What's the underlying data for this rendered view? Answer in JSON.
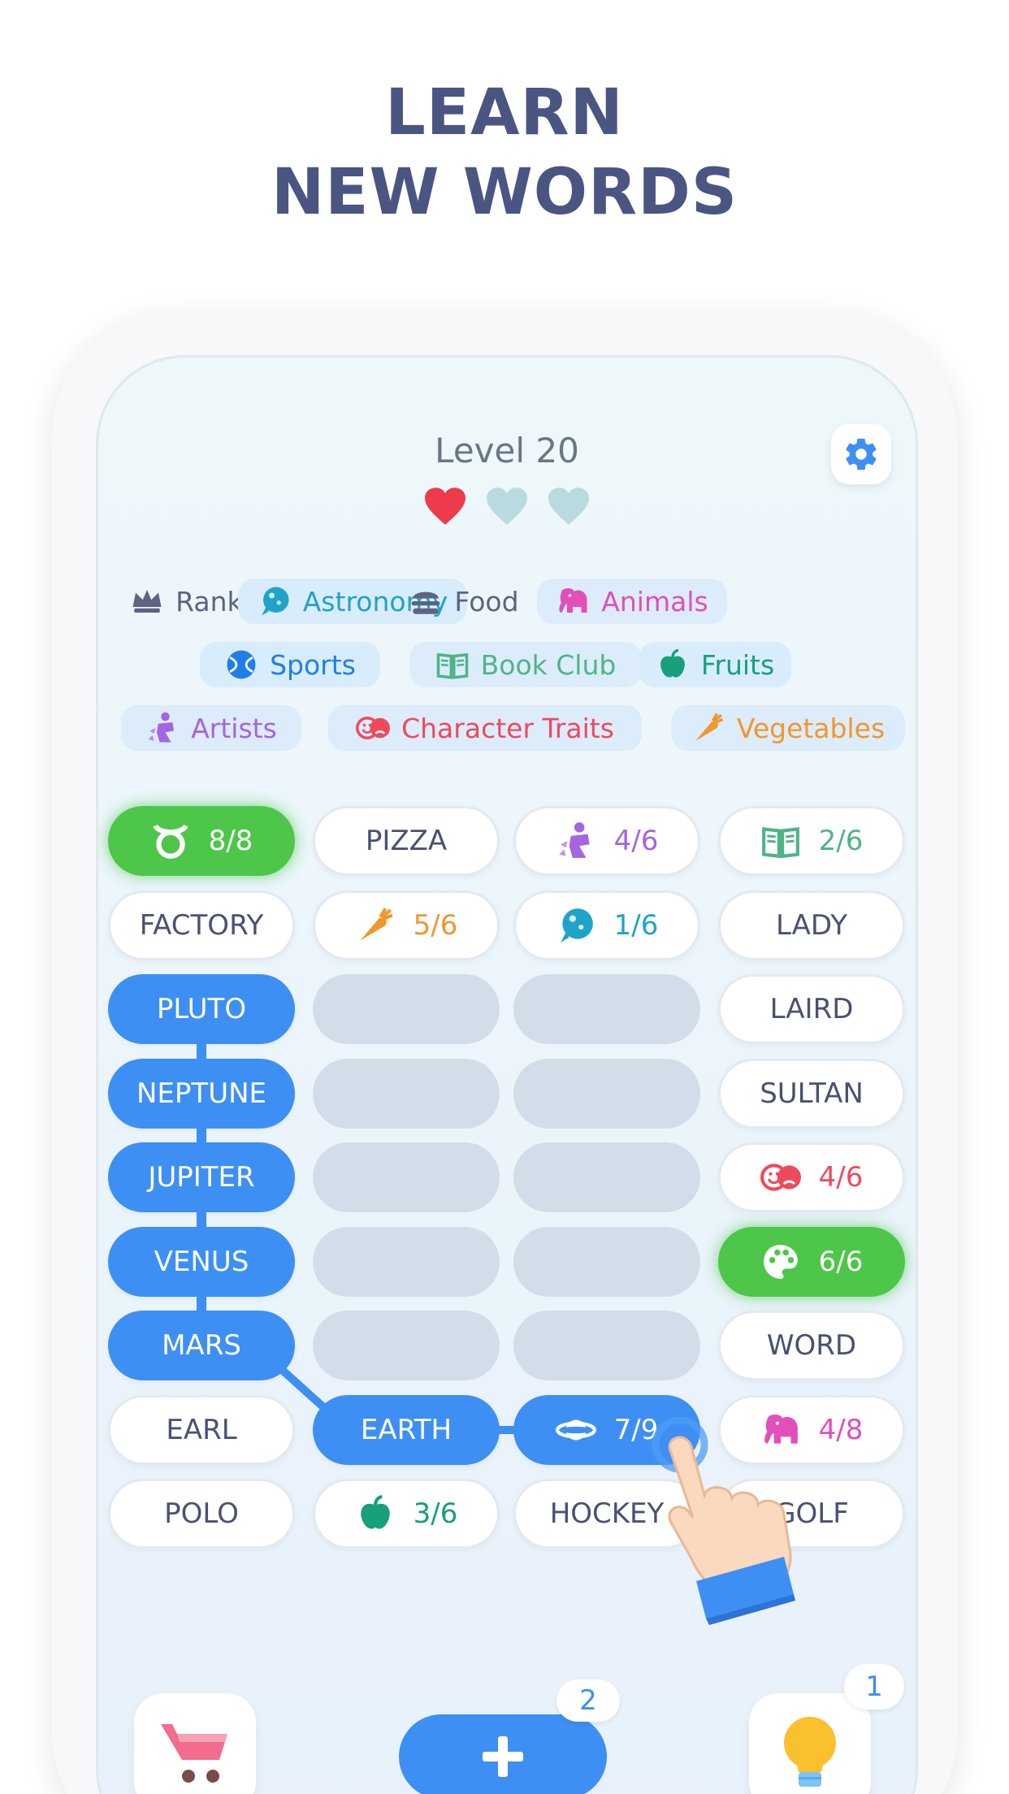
{
  "headline": {
    "line1": "LEARN",
    "line2": "NEW WORDS"
  },
  "level": {
    "title": "Level 20",
    "lives_total": 3,
    "lives_filled": 1
  },
  "colors": {
    "accent_blue": "#3d8ff3",
    "success_green": "#4dc64a",
    "heart_red": "#ef3a4c",
    "heart_empty": "#b9dbe0",
    "headline": "#4a5582"
  },
  "categories": [
    {
      "label": "Ranks",
      "icon": "crown-icon",
      "color": "#5d6380",
      "bg": "transparent"
    },
    {
      "label": "Astronomy",
      "icon": "planet-icon",
      "color": "#1fa3c9",
      "bg": "#d9ecfb"
    },
    {
      "label": "Food",
      "icon": "burger-icon",
      "color": "#5d6380",
      "bg": "transparent"
    },
    {
      "label": "Animals",
      "icon": "elephant-icon",
      "color": "#e24fba",
      "bg": "#dcecfb"
    },
    {
      "label": "Sports",
      "icon": "ball-icon",
      "color": "#1f7fe6",
      "bg": "#d9ecfb"
    },
    {
      "label": "Book Club",
      "icon": "book-icon",
      "color": "#4fb488",
      "bg": "#dcecfb"
    },
    {
      "label": "Fruits",
      "icon": "apple-icon",
      "color": "#17a07a",
      "bg": "#d9ecfb"
    },
    {
      "label": "Artists",
      "icon": "artist-icon",
      "color": "#a465e2",
      "bg": "#dcecfb"
    },
    {
      "label": "Character Traits",
      "icon": "masks-icon",
      "color": "#ee4a5c",
      "bg": "#dcecfb"
    },
    {
      "label": "Vegetables",
      "icon": "carrot-icon",
      "color": "#f0972e",
      "bg": "#dcecfb"
    }
  ],
  "grid": [
    [
      {
        "text": "8/8",
        "icon": "taurus-icon",
        "style": "green"
      },
      {
        "text": "PIZZA",
        "style": "white"
      },
      {
        "text": "4/6",
        "icon": "artist-icon",
        "style": "white",
        "color": "#a465e2"
      },
      {
        "text": "2/6",
        "icon": "book-icon",
        "style": "white",
        "color": "#4fb488"
      }
    ],
    [
      {
        "text": "FACTORY",
        "style": "white"
      },
      {
        "text": "5/6",
        "icon": "carrot-icon",
        "style": "white",
        "color": "#f0972e"
      },
      {
        "text": "1/6",
        "icon": "planet-icon",
        "style": "white",
        "color": "#1fa3c9"
      },
      {
        "text": "LADY",
        "style": "white"
      }
    ],
    [
      {
        "text": "PLUTO",
        "style": "blue"
      },
      {
        "text": "",
        "style": "empty"
      },
      {
        "text": "",
        "style": "empty"
      },
      {
        "text": "LAIRD",
        "style": "white"
      }
    ],
    [
      {
        "text": "NEPTUNE",
        "style": "blue"
      },
      {
        "text": "",
        "style": "empty"
      },
      {
        "text": "",
        "style": "empty"
      },
      {
        "text": "SULTAN",
        "style": "white"
      }
    ],
    [
      {
        "text": "JUPITER",
        "style": "blue"
      },
      {
        "text": "",
        "style": "empty"
      },
      {
        "text": "",
        "style": "empty"
      },
      {
        "text": "4/6",
        "icon": "masks-icon",
        "style": "white",
        "color": "#ee4a5c"
      }
    ],
    [
      {
        "text": "VENUS",
        "style": "blue"
      },
      {
        "text": "",
        "style": "empty"
      },
      {
        "text": "",
        "style": "empty"
      },
      {
        "text": "6/6",
        "icon": "palette-icon",
        "style": "green"
      }
    ],
    [
      {
        "text": "MARS",
        "style": "blue"
      },
      {
        "text": "",
        "style": "empty"
      },
      {
        "text": "",
        "style": "empty"
      },
      {
        "text": "WORD",
        "style": "white"
      }
    ],
    [
      {
        "text": "EARL",
        "style": "white"
      },
      {
        "text": "EARTH",
        "style": "blue"
      },
      {
        "text": "7/9",
        "icon": "saturn-icon",
        "style": "blue"
      },
      {
        "text": "4/8",
        "icon": "elephant-icon",
        "style": "white",
        "color": "#e24fba"
      }
    ],
    [
      {
        "text": "POLO",
        "style": "white"
      },
      {
        "text": "3/6",
        "icon": "apple-icon",
        "style": "white",
        "color": "#17a07a"
      },
      {
        "text": "HOCKEY",
        "style": "white"
      },
      {
        "text": "GOLF",
        "style": "white"
      }
    ]
  ],
  "bottom": {
    "add_badge": "2",
    "hint_badge": "1",
    "shop_icon": "cart-icon",
    "add_icon": "plus-icon",
    "hint_icon": "lightbulb-icon"
  }
}
